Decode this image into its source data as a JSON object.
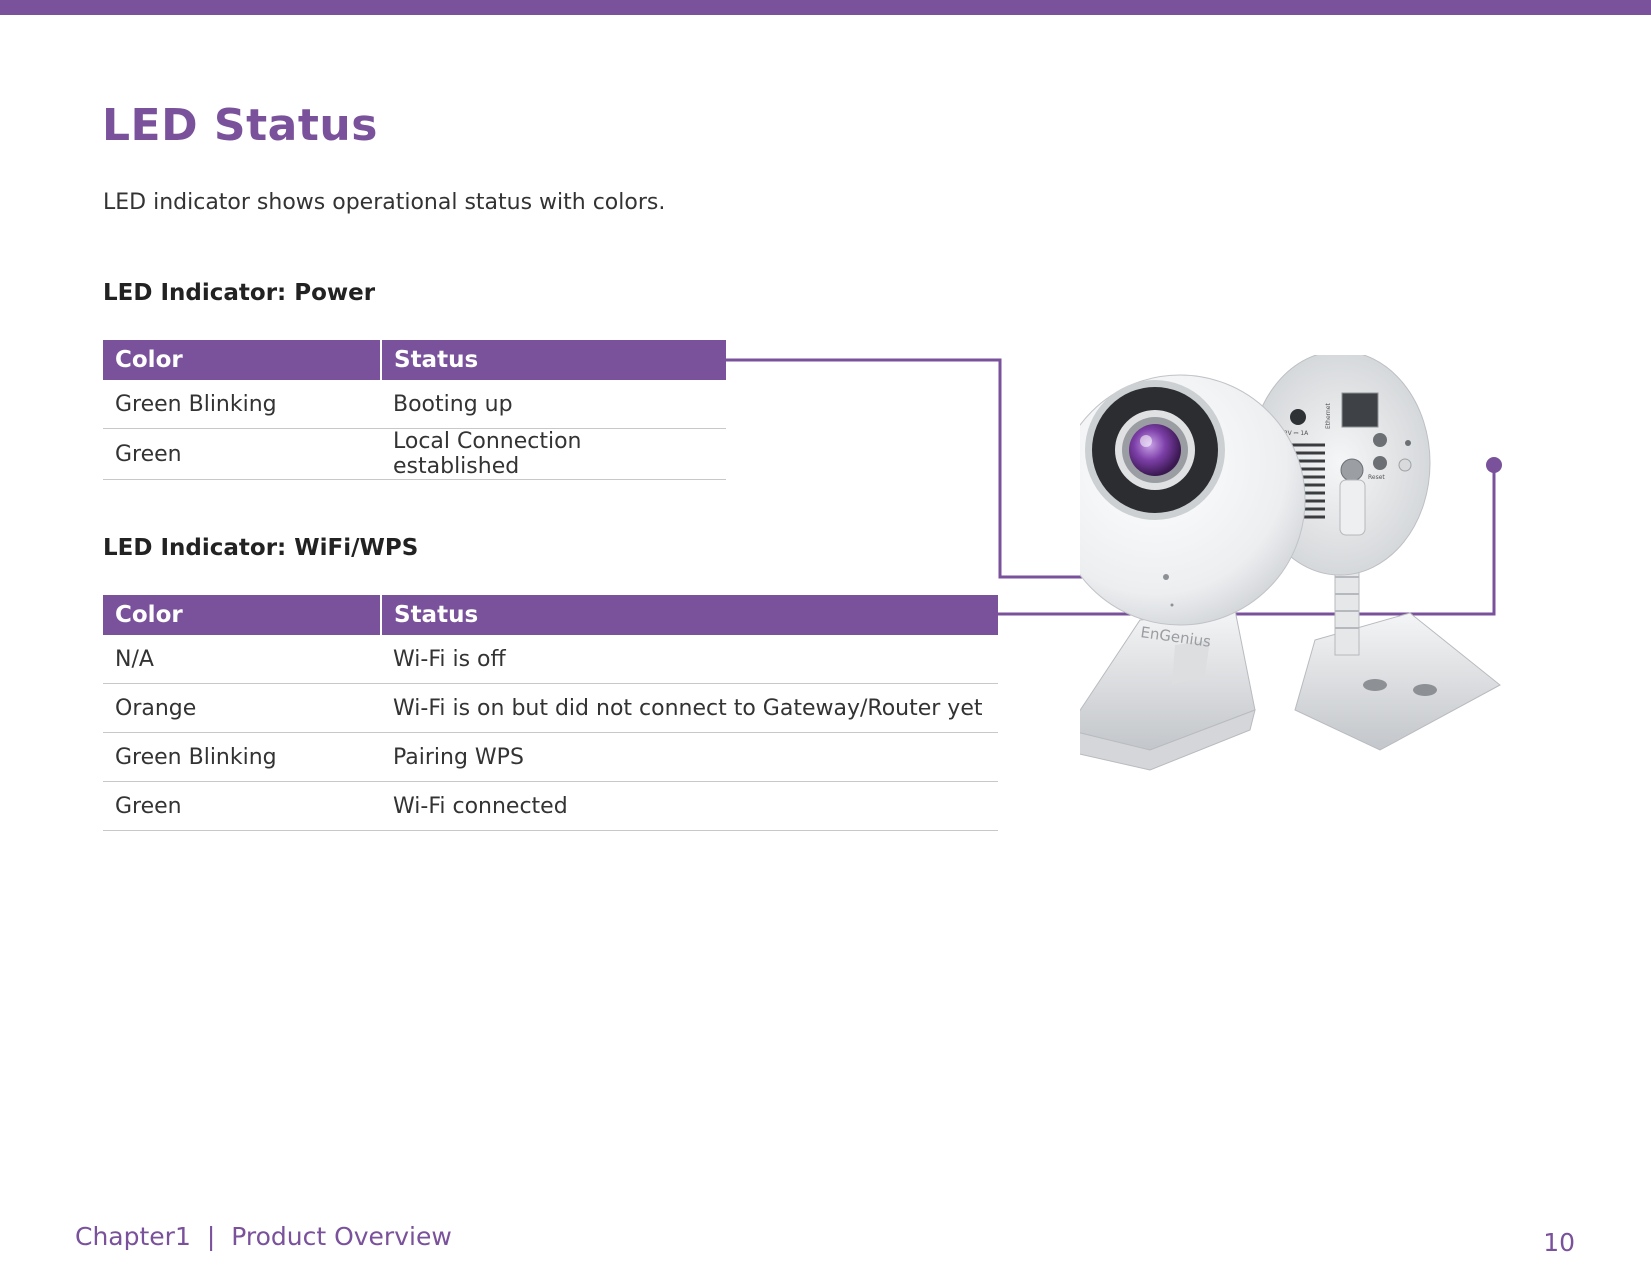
{
  "page": {
    "title": "LED Status",
    "intro": "LED indicator shows operational status with colors.",
    "accent_color": "#7a519b"
  },
  "power_table": {
    "heading": "LED Indicator: Power",
    "columns": [
      "Color",
      "Status"
    ],
    "rows": [
      [
        "Green Blinking",
        "Booting up"
      ],
      [
        "Green",
        "Local Connection established"
      ]
    ]
  },
  "wifi_table": {
    "heading": "LED Indicator: WiFi/WPS",
    "columns": [
      "Color",
      "Status"
    ],
    "rows": [
      [
        "N/A",
        "Wi-Fi is off"
      ],
      [
        "Orange",
        "Wi-Fi is on but did not connect to Gateway/Router yet"
      ],
      [
        "Green Blinking",
        "Pairing WPS"
      ],
      [
        "Green",
        "Wi-Fi connected"
      ]
    ]
  },
  "figure": {
    "brand_logo_text": "EnGenius",
    "back_panel_labels": [
      "12V ⎓ 1A",
      "Ethernet",
      "Reset"
    ]
  },
  "footer": {
    "chapter": "Chapter1",
    "separator": "|",
    "section": "Product Overview",
    "page_number": "10"
  }
}
